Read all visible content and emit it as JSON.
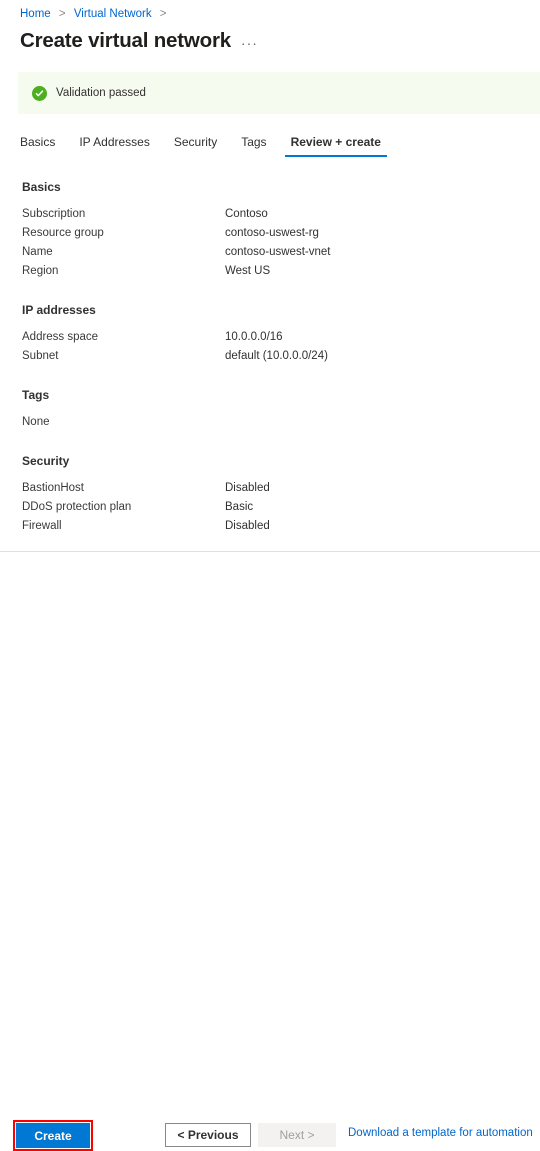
{
  "breadcrumb": {
    "items": [
      {
        "label": "Home"
      },
      {
        "label": "Virtual Network"
      }
    ],
    "separator": ">"
  },
  "header": {
    "title": "Create virtual network",
    "overflow_menu": "···"
  },
  "banner": {
    "icon": "check-circle-icon",
    "text": "Validation passed",
    "background_color": "#f6fbf0",
    "icon_color": "#4caf21"
  },
  "tabs": [
    {
      "label": "Basics",
      "active": false
    },
    {
      "label": "IP Addresses",
      "active": false
    },
    {
      "label": "Security",
      "active": false
    },
    {
      "label": "Tags",
      "active": false
    },
    {
      "label": "Review + create",
      "active": true
    }
  ],
  "accent_color": "#0078d4",
  "link_color": "#0066cc",
  "highlight_color": "#ff0000",
  "sections": [
    {
      "title": "Basics",
      "rows": [
        {
          "label": "Subscription",
          "value": "Contoso"
        },
        {
          "label": "Resource group",
          "value": "contoso-uswest-rg"
        },
        {
          "label": "Name",
          "value": "contoso-uswest-vnet"
        },
        {
          "label": "Region",
          "value": "West US"
        }
      ]
    },
    {
      "title": "IP addresses",
      "rows": [
        {
          "label": "Address space",
          "value": "10.0.0.0/16"
        },
        {
          "label": "Subnet",
          "value": "default (10.0.0.0/24)"
        }
      ]
    },
    {
      "title": "Tags",
      "empty_text": "None",
      "rows": []
    },
    {
      "title": "Security",
      "rows": [
        {
          "label": "BastionHost",
          "value": "Disabled"
        },
        {
          "label": "DDoS protection plan",
          "value": "Basic"
        },
        {
          "label": "Firewall",
          "value": "Disabled"
        }
      ]
    }
  ],
  "footer": {
    "create_label": "Create",
    "previous_label": "< Previous",
    "next_label": "Next >",
    "next_disabled": true,
    "download_link_label": "Download a template for automation"
  }
}
